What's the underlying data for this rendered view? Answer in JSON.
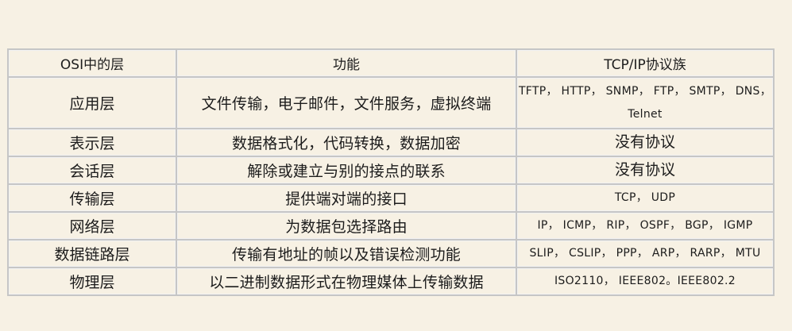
{
  "table": {
    "headers": [
      "OSI中的层",
      "功能",
      "TCP/IP协议族"
    ],
    "rows": [
      {
        "layer": "应用层",
        "function": "文件传输，电子邮件，文件服务，虚拟终端",
        "protocols": "TFTP， HTTP， SNMP， FTP， SMTP， DNS， Telnet"
      },
      {
        "layer": "表示层",
        "function": "数据格式化，代码转换，数据加密",
        "protocols": "没有协议"
      },
      {
        "layer": "会话层",
        "function": "解除或建立与别的接点的联系",
        "protocols": "没有协议"
      },
      {
        "layer": "传输层",
        "function": "提供端对端的接口",
        "protocols": "TCP， UDP"
      },
      {
        "layer": "网络层",
        "function": "为数据包选择路由",
        "protocols": "IP， ICMP， RIP， OSPF， BGP， IGMP"
      },
      {
        "layer": "数据链路层",
        "function": "传输有地址的帧以及错误检测功能",
        "protocols": "SLIP， CSLIP， PPP， ARP， RARP， MTU"
      },
      {
        "layer": "物理层",
        "function": "以二进制数据形式在物理媒体上传输数据",
        "protocols": "ISO2110， IEEE802。IEEE802.2"
      }
    ]
  }
}
